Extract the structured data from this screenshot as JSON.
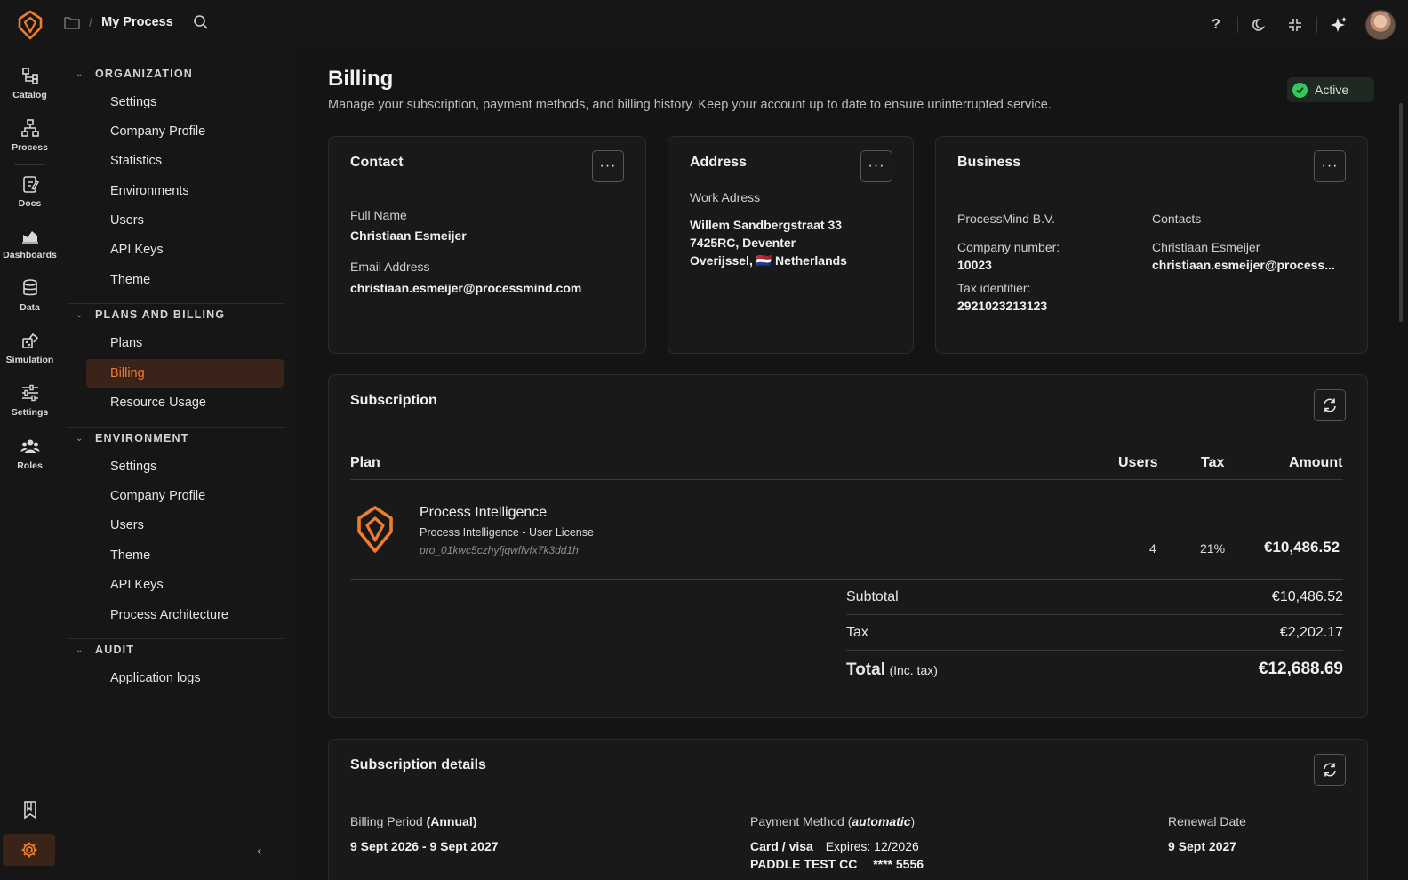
{
  "header": {
    "title": "My Process",
    "separator": "/"
  },
  "rail": {
    "items": [
      {
        "label": "Catalog",
        "icon": "catalog-icon"
      },
      {
        "label": "Process",
        "icon": "process-icon"
      },
      {
        "label": "Docs",
        "icon": "docs-icon"
      },
      {
        "label": "Dashboards",
        "icon": "dashboards-icon"
      },
      {
        "label": "Data",
        "icon": "data-icon"
      },
      {
        "label": "Simulation",
        "icon": "simulation-icon"
      },
      {
        "label": "Settings",
        "icon": "settings-sliders-icon"
      },
      {
        "label": "Roles",
        "icon": "roles-icon"
      }
    ]
  },
  "sidebar": {
    "sections": [
      {
        "title": "ORGANIZATION",
        "items": [
          "Settings",
          "Company Profile",
          "Statistics",
          "Environments",
          "Users",
          "API Keys",
          "Theme"
        ]
      },
      {
        "title": "PLANS AND BILLING",
        "items": [
          "Plans",
          "Billing",
          "Resource Usage"
        ]
      },
      {
        "title": "ENVIRONMENT",
        "items": [
          "Settings",
          "Company Profile",
          "Users",
          "Theme",
          "API Keys",
          "Process Architecture"
        ]
      },
      {
        "title": "AUDIT",
        "items": [
          "Application logs"
        ]
      }
    ],
    "active_item": "Billing"
  },
  "page": {
    "title": "Billing",
    "subtitle": "Manage your subscription, payment methods, and billing history. Keep your account up to date to ensure uninterrupted service.",
    "status": "Active"
  },
  "contact": {
    "title": "Contact",
    "full_name_label": "Full Name",
    "full_name": "Christiaan Esmeijer",
    "email_label": "Email Address",
    "email": "christiaan.esmeijer@processmind.com"
  },
  "address": {
    "title": "Address",
    "label": "Work Adress",
    "line1": "Willem Sandbergstraat 33",
    "line2": "7425RC, Deventer",
    "line3_region": "Overijssel,",
    "line3_flag": "🇳🇱",
    "line3_country": "Netherlands"
  },
  "business": {
    "title": "Business",
    "company": "ProcessMind B.V.",
    "company_number_label": "Company number:",
    "company_number": "10023",
    "tax_label": "Tax identifier:",
    "tax_id": "2921023213123",
    "contacts_label": "Contacts",
    "contact_name": "Christiaan Esmeijer",
    "contact_email": "christiaan.esmeijer@process..."
  },
  "subscription": {
    "title": "Subscription",
    "columns": {
      "plan": "Plan",
      "users": "Users",
      "tax": "Tax",
      "amount": "Amount"
    },
    "plan_name": "Process Intelligence",
    "plan_desc": "Process Intelligence - User License",
    "plan_id": "pro_01kwc5czhyfjqwffvfx7k3dd1h",
    "users": "4",
    "tax": "21%",
    "amount": "€10,486.52",
    "subtotal_label": "Subtotal",
    "subtotal": "€10,486.52",
    "tax_label": "Tax",
    "tax_amount": "€2,202.17",
    "total_label": "Total",
    "total_note": "(Inc. tax)",
    "total": "€12,688.69"
  },
  "details": {
    "title": "Subscription details",
    "billing_period_label": "Billing Period",
    "billing_period_type": "(Annual)",
    "billing_period": "9 Sept 2026 - 9 Sept 2027",
    "payment_label": "Payment Method (",
    "payment_mode": "automatic",
    "payment_label_end": ")",
    "card": "Card / visa",
    "expires": "Expires: 12/2026",
    "card_holder": "PADDLE TEST CC",
    "card_number": "**** 5556",
    "renewal_label": "Renewal Date",
    "renewal_date": "9 Sept 2027"
  },
  "colors": {
    "accent": "#f07c2e",
    "success": "#34c759"
  }
}
